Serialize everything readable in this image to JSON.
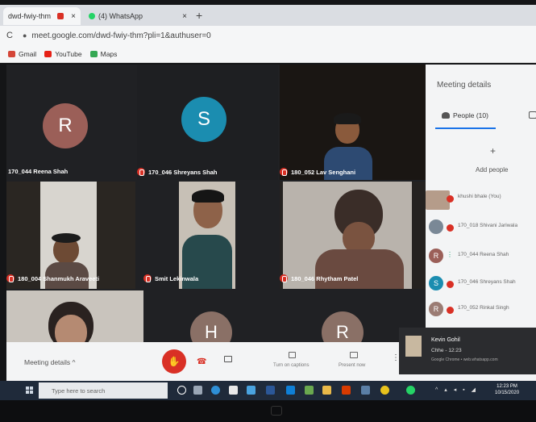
{
  "browser": {
    "tab1_title": "dwd-fwiy-thm",
    "tab2_title": "(4) WhatsApp",
    "new_tab": "+",
    "close": "×",
    "url": "meet.google.com/dwd-fwiy-thm?pli=1&authuser=0",
    "bookmarks": [
      "Gmail",
      "YouTube",
      "Maps"
    ]
  },
  "tiles": [
    {
      "initial": "R",
      "name": "170_044 Reena Shah",
      "avatar_color": "#9b5f58"
    },
    {
      "initial": "S",
      "name": "170_046 Shreyans Shah",
      "avatar_color": "#1b8db0"
    },
    {
      "name": "180_052 Lav Senghani"
    },
    {
      "name": "180_004 Shanmukh Araveeti"
    },
    {
      "name": "Smit Lekinwala"
    },
    {
      "name": "180_046 Rhytham Patel"
    },
    {
      "initial": "H",
      "avatar_color": "#8a7066"
    },
    {
      "initial": "R",
      "avatar_color": "#8a7066"
    }
  ],
  "panel": {
    "title": "Meeting details",
    "people_tab": "People (10)",
    "add_people": "Add people",
    "participants": [
      {
        "name": "khushi bhale (You)",
        "initial": "",
        "color": "#b59c8a"
      },
      {
        "name": "170_018 Shivani Jariwala",
        "initial": "",
        "color": "#7a8896"
      },
      {
        "name": "170_044 Reena Shah",
        "initial": "R",
        "color": "#9b5f58"
      },
      {
        "name": "170_046 Shreyans Shah",
        "initial": "S",
        "color": "#1b8db0"
      },
      {
        "name": "170_052 Rinkal Singh",
        "initial": "R",
        "color": "#9b7c74"
      }
    ]
  },
  "bottombar": {
    "meeting_details": "Meeting details ^",
    "captions": "Turn on captions",
    "present": "Present now"
  },
  "notification": {
    "name": "Kevin Gohil",
    "message": "Chhe - 12:23",
    "source": "Google Chrome • web.whatsapp.com"
  },
  "taskbar": {
    "search_placeholder": "Type here to search",
    "time": "12:23 PM",
    "date": "10/15/2020"
  }
}
